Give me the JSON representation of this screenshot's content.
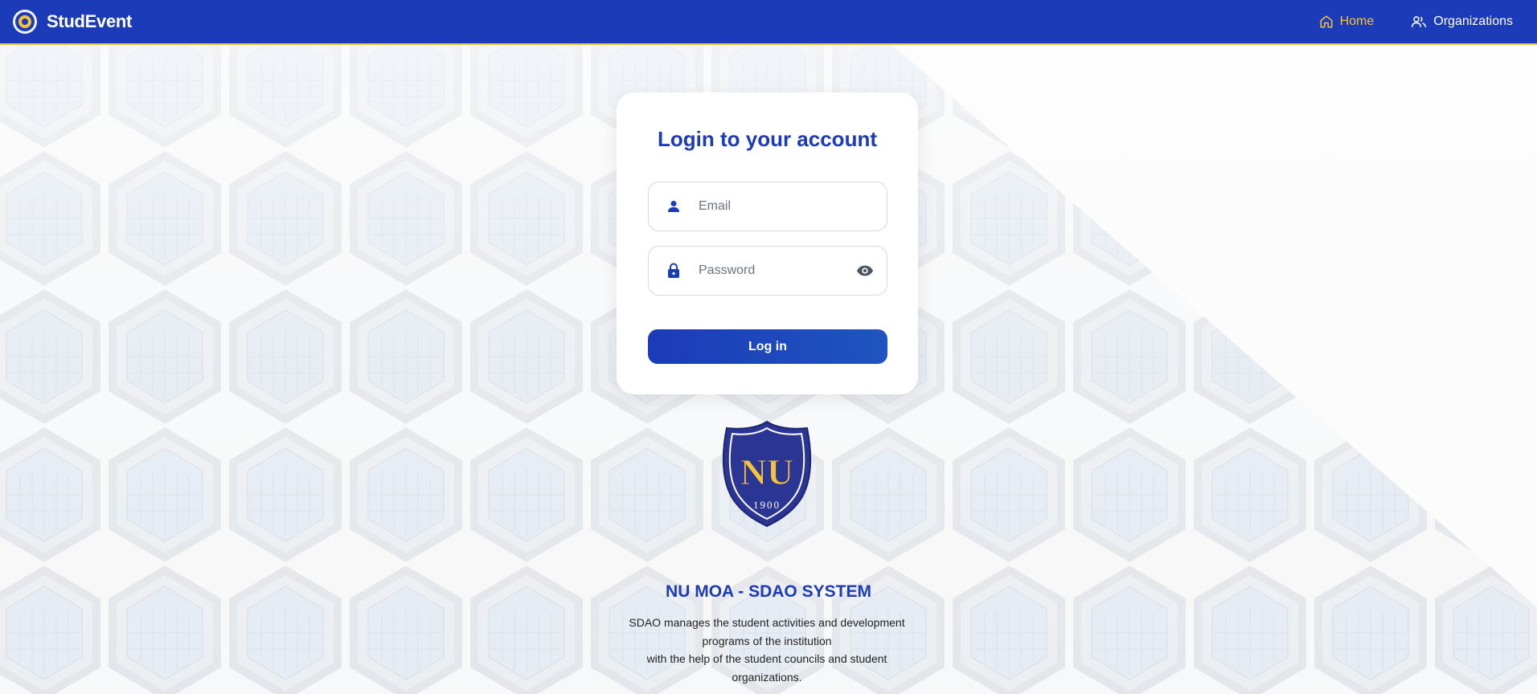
{
  "navbar": {
    "brand": "StudEvent",
    "links": [
      {
        "label": "Home",
        "icon": "home-icon",
        "active": true
      },
      {
        "label": "Organizations",
        "icon": "users-icon",
        "active": false
      }
    ],
    "colors": {
      "background": "#1b3bb8",
      "active": "#f5c23a",
      "border": "#f2c94c"
    }
  },
  "login": {
    "title": "Login to your account",
    "email_placeholder": "Email",
    "password_placeholder": "Password",
    "submit_label": "Log in"
  },
  "crest": {
    "letters": "NU",
    "year": "1900"
  },
  "system": {
    "title": "NU MOA - SDAO SYSTEM",
    "description_line1": "SDAO manages the student activities and development programs of the institution",
    "description_line2": "with the help of the student councils and student organizations."
  }
}
